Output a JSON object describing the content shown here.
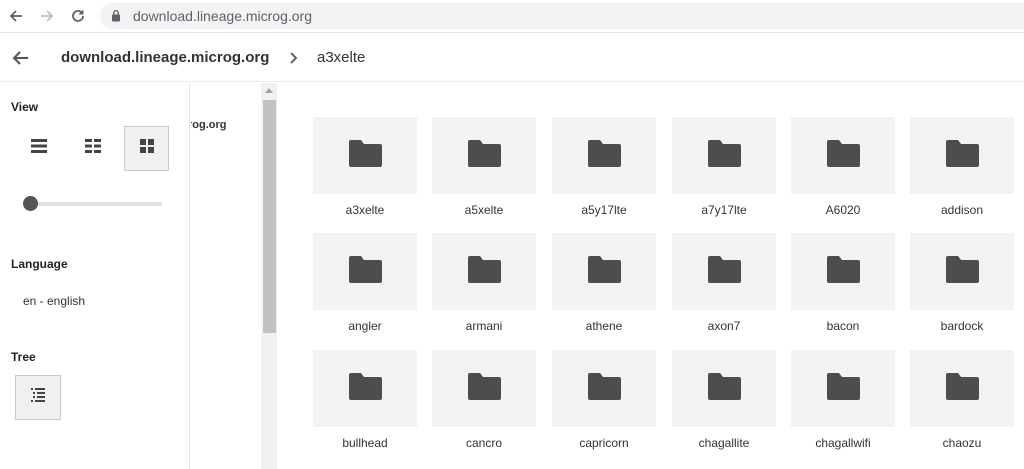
{
  "browser": {
    "url": "download.lineage.microg.org"
  },
  "header": {
    "breadcrumb_root": "download.lineage.microg.org",
    "breadcrumb_current": "a3xelte"
  },
  "sidebar": {
    "view_title": "View",
    "view_modes": [
      "list",
      "compact-grid",
      "large-grid"
    ],
    "active_view": "large-grid",
    "thumb_size_level": 0.0,
    "language_title": "Language",
    "language_option": "en - english",
    "tree_title": "Tree"
  },
  "tree": {
    "visible_text": "rog.org"
  },
  "folders": [
    [
      "a3xelte",
      "a5xelte",
      "a5y17lte",
      "a7y17lte",
      "A6020",
      "addison"
    ],
    [
      "angler",
      "armani",
      "athene",
      "axon7",
      "bacon",
      "bardock"
    ],
    [
      "bullhead",
      "cancro",
      "capricorn",
      "chagallite",
      "chagallwifi",
      "chaozu"
    ]
  ],
  "colors": {
    "folder_icon": "#4d4d4d",
    "thumb_bg": "#f3f3f3",
    "active_button_bg": "#f0f0f0"
  }
}
